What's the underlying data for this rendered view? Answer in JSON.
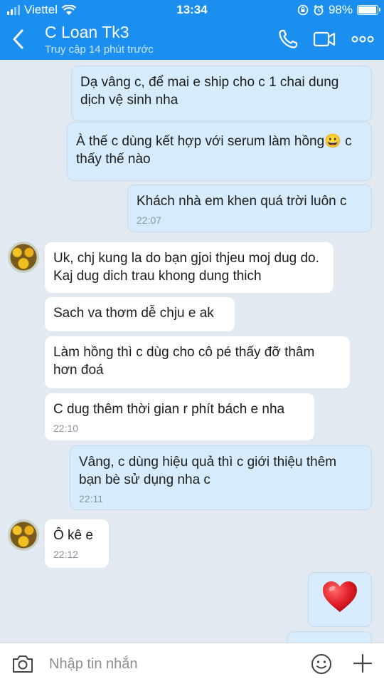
{
  "status": {
    "carrier": "Viettel",
    "time": "13:34",
    "battery": "98%",
    "battery_level": 0.98
  },
  "header": {
    "name": "C Loan Tk3",
    "subtitle": "Truy cập 14 phút trước"
  },
  "messages": [
    {
      "side": "out",
      "text": "Dạ vâng c, để mai e ship cho c 1 chai dung dịch vệ sinh nha"
    },
    {
      "side": "out",
      "text": "À thế c dùng kết hợp với serum làm hồng😀 c thấy thế nào"
    },
    {
      "side": "out",
      "text": "Khách nhà em khen quá trời luôn c",
      "time": "22:07"
    },
    {
      "side": "in",
      "text": "Uk, chj kung la do bạn gjoi thjeu moj dug do. Kaj dug dich trau khong dung thich"
    },
    {
      "side": "in",
      "text": "Sach va thơm dễ chju e ak"
    },
    {
      "side": "in",
      "text": "Làm hồng thì c dùg cho cô pé thấy đỡ thâm hơn đoá"
    },
    {
      "side": "in",
      "text": "C dug thêm thời gian r phít bách e nha",
      "time": "22:10"
    },
    {
      "side": "out",
      "text": "Vâng, c dùng hiệu quả thì c giới thiệu thêm bạn bè sử dụng nha c",
      "time": "22:11"
    },
    {
      "side": "in",
      "text": "Ô kê e",
      "time": "22:12"
    },
    {
      "side": "out",
      "sticker": "heart"
    }
  ],
  "input": {
    "placeholder": "Nhập tin nhắn"
  },
  "colors": {
    "accent": "#1a8ff0",
    "bubble_out": "#d6ebfb",
    "bubble_in": "#ffffff",
    "background": "#e2e9f1",
    "heart": "#e3202a"
  }
}
